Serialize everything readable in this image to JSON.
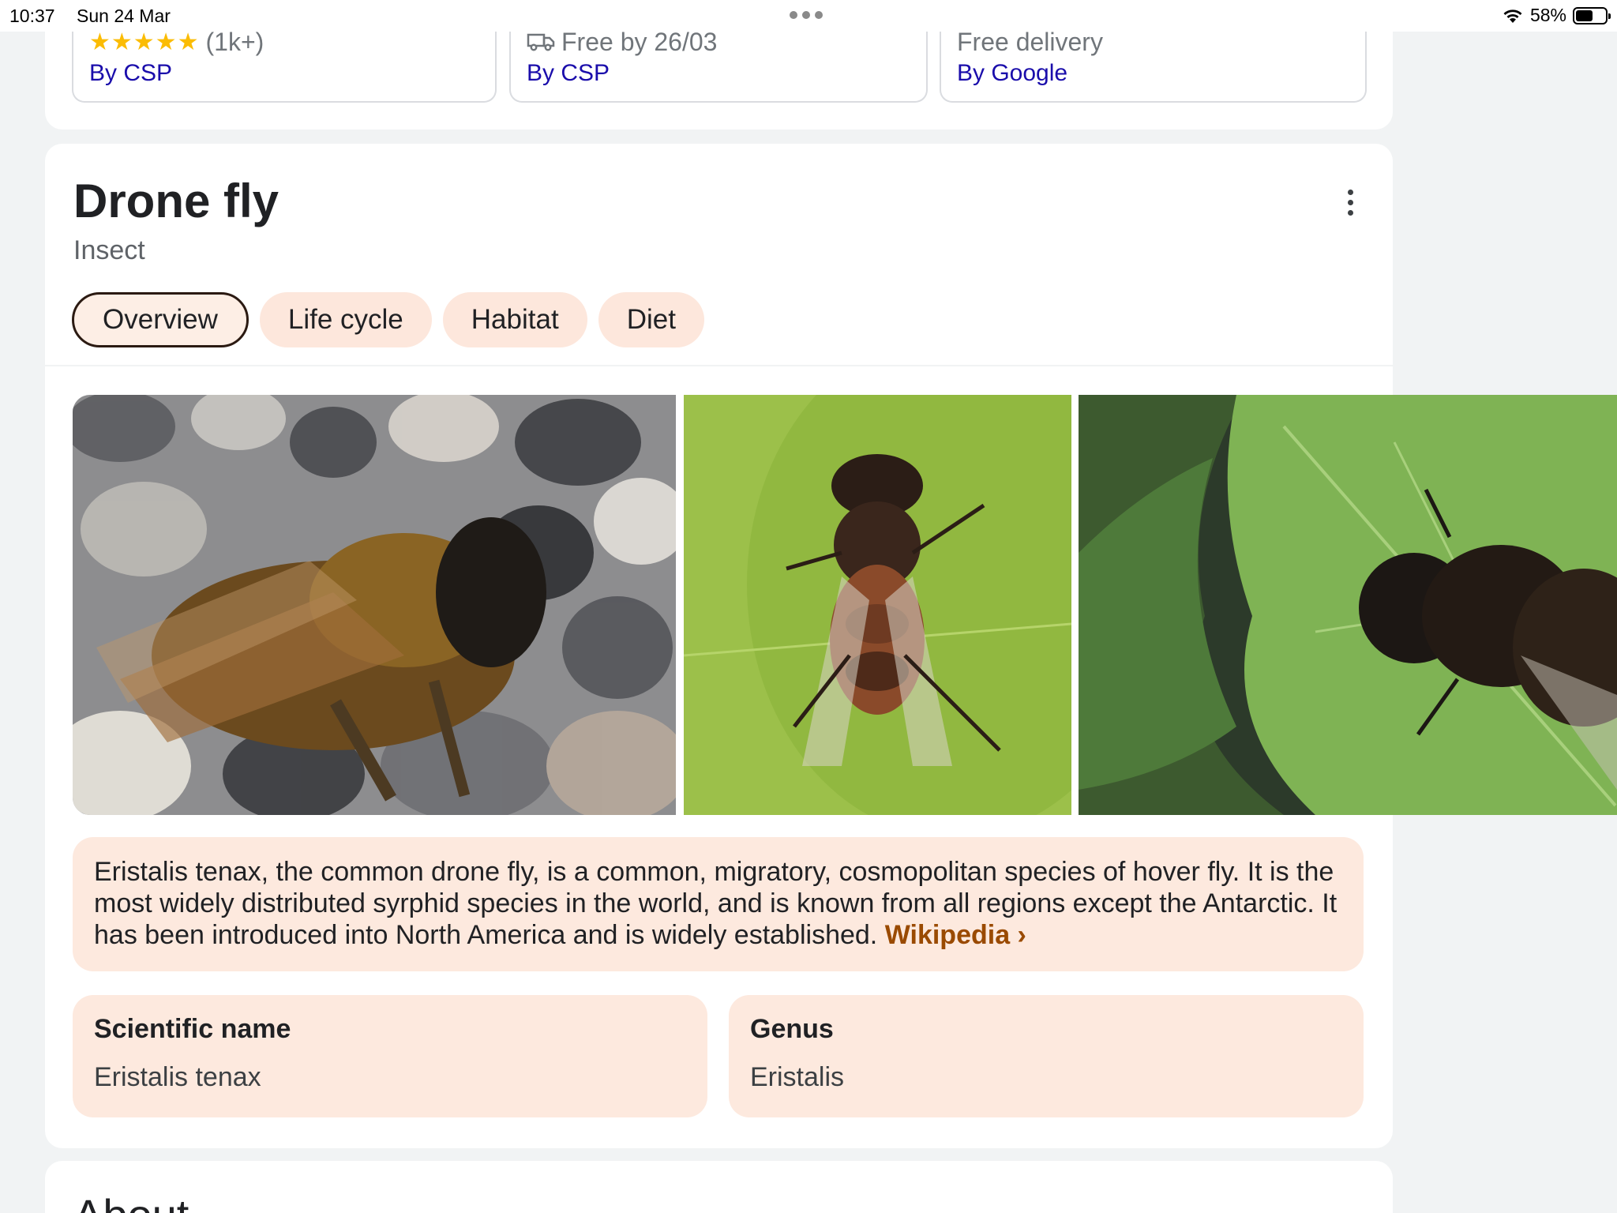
{
  "status_bar": {
    "time": "10:37",
    "date": "Sun 24 Mar",
    "battery": "58%",
    "battery_level": 0.58
  },
  "offers": [
    {
      "line1": "(1k+)",
      "stars": "★★★★★",
      "line2": "By CSP",
      "icon": "star-rating"
    },
    {
      "line1": "Free by 26/03",
      "line2": "By CSP",
      "icon": "truck-icon"
    },
    {
      "line1": "Free delivery",
      "line2": "By Google"
    }
  ],
  "entity": {
    "title": "Drone fly",
    "subtitle": "Insect"
  },
  "tabs": [
    {
      "label": "Overview",
      "active": true
    },
    {
      "label": "Life cycle"
    },
    {
      "label": "Habitat"
    },
    {
      "label": "Diet"
    }
  ],
  "description": {
    "text": "Eristalis tenax, the common drone fly, is a common, migratory, cosmopolitan species of hover fly. It is the most widely distributed syrphid species in the world, and is known from all regions except the Antarctic. It has been introduced into North America and is widely established.",
    "link_label": "Wikipedia ›"
  },
  "facts": [
    {
      "label": "Scientific name",
      "value": "Eristalis tenax"
    },
    {
      "label": "Genus",
      "value": "Eristalis"
    }
  ],
  "about": {
    "title": "About"
  },
  "colors": {
    "chip_bg": "#fde7dc",
    "card_bg": "#fde9de",
    "link_blue": "#1a0dab",
    "wiki_link": "#9a4a00",
    "star": "#fbbc04"
  }
}
